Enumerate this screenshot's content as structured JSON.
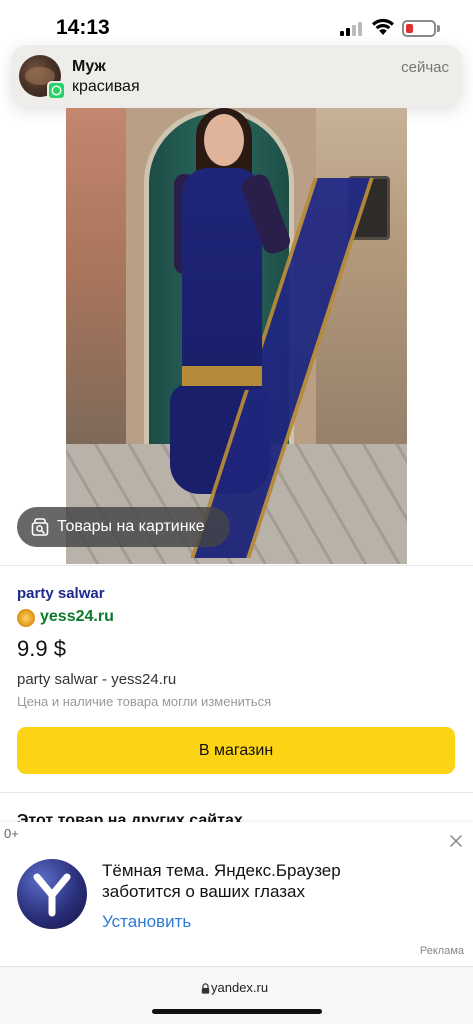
{
  "status_bar": {
    "time": "14:13"
  },
  "notification": {
    "sender": "Муж",
    "message": "красивая",
    "time": "сейчас",
    "app_icon": "whatsapp-icon"
  },
  "product_image": {
    "visual_search_label": "Товары на картинке"
  },
  "product": {
    "title": "party salwar",
    "shop": "yess24.ru",
    "price": "9.9 $",
    "description": "party salwar - yess24.ru",
    "note": "Цена и наличие товара могли измениться",
    "button_label": "В магазин"
  },
  "other_sites": {
    "heading": "Этот товар на других сайтах"
  },
  "ad": {
    "zero_label": "0+",
    "text": "Тёмная тема. Яндекс.Браузер заботится о ваших глазах",
    "install_label": "Установить",
    "ad_label": "Реклама"
  },
  "url_bar": {
    "url": "yandex.ru"
  },
  "colors": {
    "accent_button": "#fcd415",
    "link_blue": "#2f7ad6",
    "shop_green": "#0b7a2a",
    "title_blue": "#1f2b8c"
  }
}
